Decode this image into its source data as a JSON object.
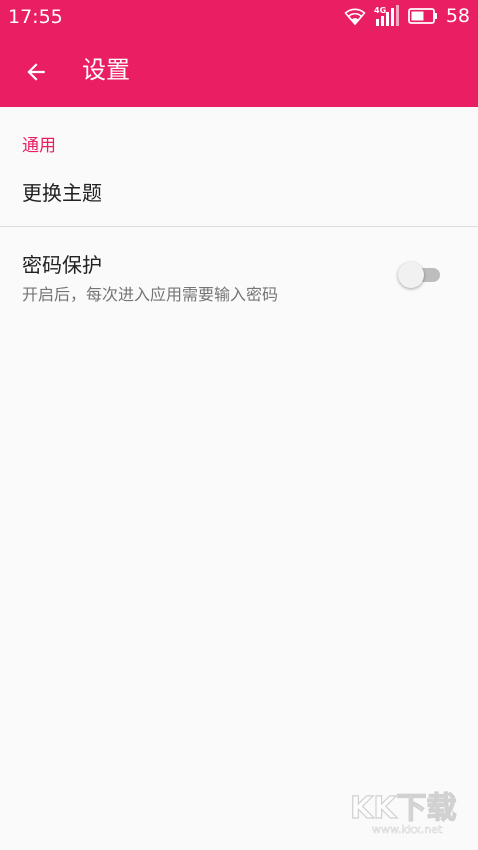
{
  "status_bar": {
    "time": "17:55",
    "network": "4G",
    "battery_level": "58",
    "icons": [
      "wifi-icon",
      "signal-icon",
      "battery-icon"
    ]
  },
  "toolbar": {
    "title": "设置",
    "back_icon": "arrow-back-icon"
  },
  "sections": {
    "general": {
      "header": "通用",
      "theme": {
        "title": "更换主题"
      },
      "password": {
        "title": "密码保护",
        "summary": "开启后，每次进入应用需要输入密码",
        "enabled": false
      }
    }
  },
  "watermark": {
    "text": "KK下载",
    "url": "www.kkx.net"
  },
  "colors": {
    "primary": "#e91e63",
    "background": "#fafafa",
    "text_primary": "#212121",
    "text_secondary": "#757575",
    "switch_track_off": "#bdbdbd",
    "switch_thumb_off": "#f1f1f1"
  }
}
